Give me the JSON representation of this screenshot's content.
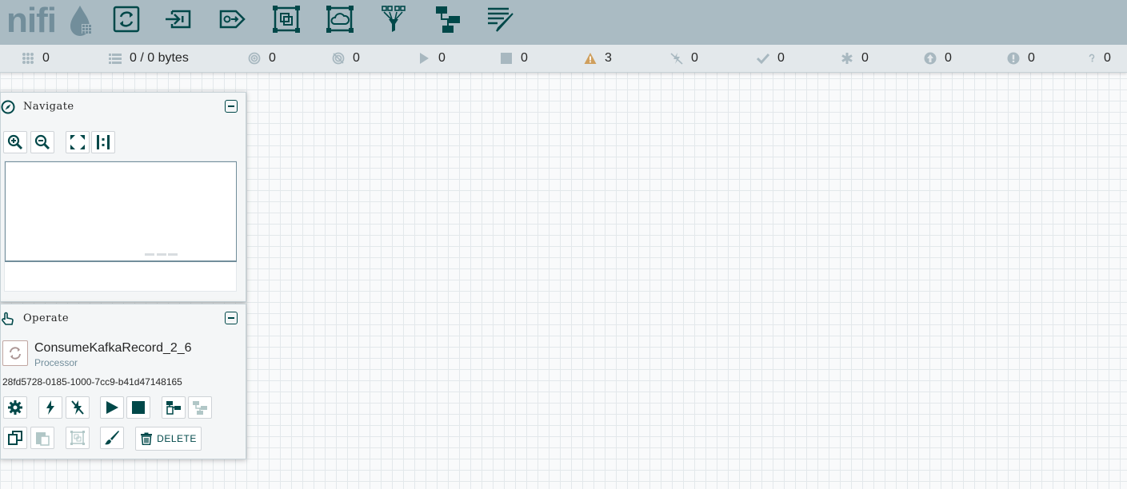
{
  "brand": {
    "logo_text": "nifi"
  },
  "colors": {
    "header_bg": "#aabbc3",
    "icon_dark": "#004849",
    "status_bg": "#e3e8eb",
    "warning": "#cf9f5d"
  },
  "toolbar": {
    "items": [
      {
        "name": "processor",
        "icon": "processor-icon"
      },
      {
        "name": "input-port",
        "icon": "input-port-icon"
      },
      {
        "name": "output-port",
        "icon": "output-port-icon"
      },
      {
        "name": "process-group",
        "icon": "process-group-icon"
      },
      {
        "name": "remote-process-group",
        "icon": "remote-process-group-icon"
      },
      {
        "name": "funnel",
        "icon": "funnel-icon"
      },
      {
        "name": "template",
        "icon": "template-icon"
      },
      {
        "name": "label",
        "icon": "label-icon"
      }
    ]
  },
  "status": {
    "active_threads": "0",
    "queued": "0 / 0 bytes",
    "transmitting": "0",
    "not_transmitting": "0",
    "running": "0",
    "stopped": "0",
    "invalid": "3",
    "disabled": "0",
    "up_to_date": "0",
    "locally_modified": "0",
    "stale": "0",
    "sync_failure": "0",
    "unknown": "0"
  },
  "navigate": {
    "title": "Navigate"
  },
  "operate": {
    "title": "Operate",
    "component_name": "ConsumeKafkaRecord_2_6",
    "component_type": "Processor",
    "component_id": "28fd5728-0185-1000-7cc9-b41d47148165",
    "delete_label": "DELETE"
  }
}
